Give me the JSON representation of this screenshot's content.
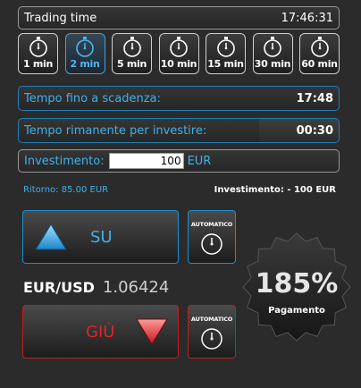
{
  "header": {
    "title": "Trading time",
    "clock": "17:46:31"
  },
  "timeframes": [
    {
      "label": "1 min",
      "active": false
    },
    {
      "label": "2 min",
      "active": true
    },
    {
      "label": "5 min",
      "active": false
    },
    {
      "label": "10 min",
      "active": false
    },
    {
      "label": "15 min",
      "active": false
    },
    {
      "label": "30 min",
      "active": false
    },
    {
      "label": "60 min",
      "active": false
    }
  ],
  "expiry": {
    "label": "Tempo fino a scadenza:",
    "value": "17:48"
  },
  "remaining": {
    "label": "Tempo rimanente per investire:",
    "value": "00:30",
    "progress_fraction": 0.25
  },
  "investment": {
    "label": "Investimento:",
    "value": "100",
    "currency": "EUR"
  },
  "summary": {
    "ritorno": "Ritorno: 85.00 EUR",
    "investimento": "Investimento: - 100 EUR"
  },
  "buttons": {
    "up_label": "SU",
    "down_label": "GIÙ",
    "auto_label": "AUTOMATICO"
  },
  "asset": {
    "pair": "EUR/USD",
    "price": "1.06424"
  },
  "payout": {
    "percent": "185%",
    "label": "Pagamento"
  },
  "colors": {
    "accent": "#3fb1ea",
    "up": "#1e8fd0",
    "down": "#d02020"
  }
}
